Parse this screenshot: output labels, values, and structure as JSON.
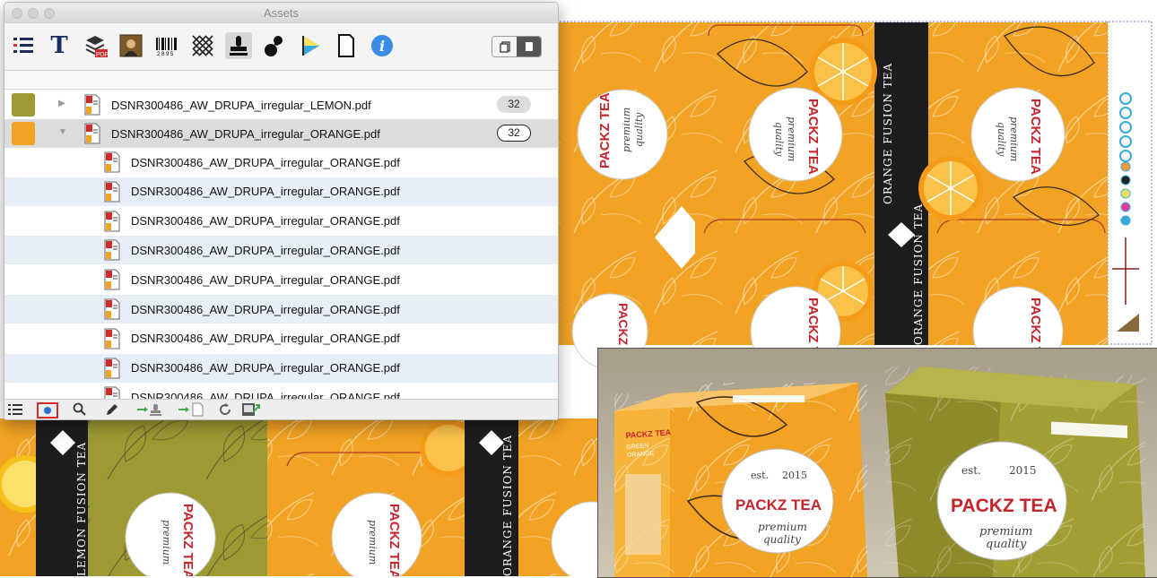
{
  "window": {
    "title": "Assets"
  },
  "toolbar": {
    "tools": [
      "list-icon",
      "text-icon",
      "layers-pdf-icon",
      "image-icon",
      "barcode-icon",
      "pattern-icon",
      "stamp-icon",
      "drop-icon",
      "color-swatch-icon",
      "page-icon",
      "info-icon"
    ],
    "active_tool": "stamp-icon",
    "view_toggle": [
      "single-page-icon",
      "page-filled-icon"
    ]
  },
  "files": [
    {
      "name": "DSNR300486_AW_DRUPA_irregular_LEMON.pdf",
      "count": "32",
      "expanded": false
    },
    {
      "name": "DSNR300486_AW_DRUPA_irregular_ORANGE.pdf",
      "count": "32",
      "expanded": true
    }
  ],
  "pages": [
    "DSNR300486_AW_DRUPA_irregular_ORANGE.pdf",
    "DSNR300486_AW_DRUPA_irregular_ORANGE.pdf",
    "DSNR300486_AW_DRUPA_irregular_ORANGE.pdf",
    "DSNR300486_AW_DRUPA_irregular_ORANGE.pdf",
    "DSNR300486_AW_DRUPA_irregular_ORANGE.pdf",
    "DSNR300486_AW_DRUPA_irregular_ORANGE.pdf",
    "DSNR300486_AW_DRUPA_irregular_ORANGE.pdf",
    "DSNR300486_AW_DRUPA_irregular_ORANGE.pdf",
    "DSNR300486_AW_DRUPA_irregular_ORANGE.pdf"
  ],
  "bottombar": {
    "tools": [
      "list-view-icon",
      "record-icon",
      "search-icon",
      "pencil-icon",
      "place-stamp-icon",
      "place-page-icon",
      "refresh-icon",
      "export-icon"
    ]
  },
  "artwork": {
    "orange_label": "ORANGE FUSION TEA",
    "lemon_label": "LEMON FUSION TEA",
    "brand": "PACKZ TEA",
    "est": "est.",
    "year": "2015",
    "tagline_1": "premium",
    "tagline_2": "quality",
    "colors": {
      "orange": "#f2a324",
      "olive": "#9d9a33",
      "black_band": "#1d1d1d",
      "brand_red": "#c6242b"
    }
  },
  "render": {
    "box1_brand": "PACKZ TEA",
    "box1_side_brand": "PACKZ TEA",
    "box1_side_sub_1": "GREEN",
    "box1_side_sub_2": "ORANGE",
    "box2_brand": "PACKZ TEA",
    "est": "est.",
    "year": "2015",
    "tagline_1": "premium",
    "tagline_2": "quality"
  }
}
